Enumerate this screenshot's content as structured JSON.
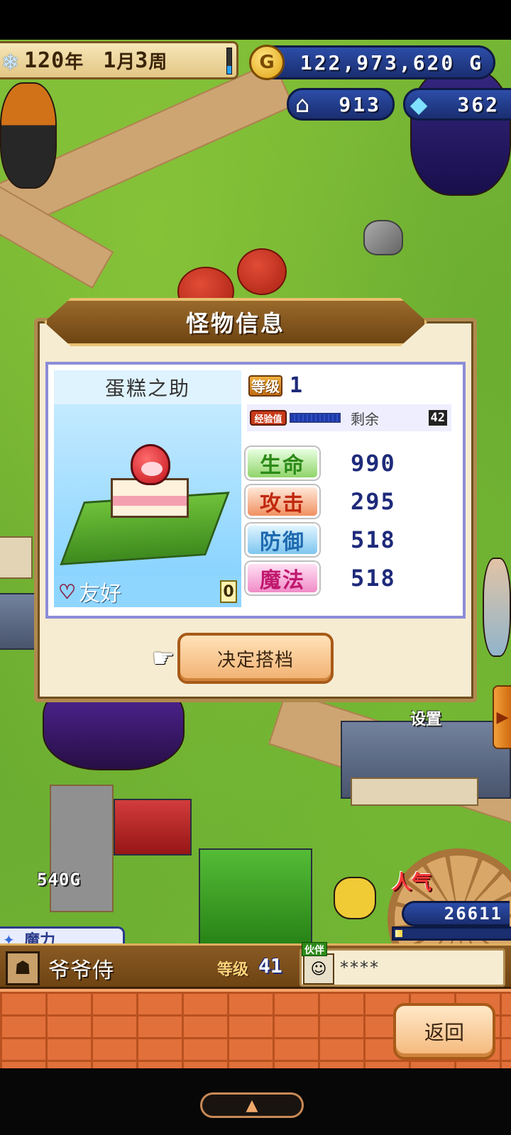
{
  "hud": {
    "date": {
      "year": "120",
      "year_unit": "年",
      "month": "1",
      "month_unit": "月",
      "week": "3",
      "week_unit": "周",
      "progress": 0.3
    },
    "gold": {
      "icon": "G",
      "amount": "122,973,620 G"
    },
    "houses": {
      "icon": "house-icon",
      "count": "913"
    },
    "crystals": {
      "icon": "crystal-icon",
      "count": "362"
    }
  },
  "dialog": {
    "title": "怪物信息",
    "monster": {
      "name": "蛋糕之助",
      "friendship_label": "友好",
      "friendship_value": "0",
      "level_label": "等级",
      "level": "1",
      "exp_label": "经验值",
      "exp_progress": 1.0,
      "exp_remain_label": "剩余",
      "exp_remain_value": "42"
    },
    "stats": [
      {
        "label": "生命",
        "value": "990"
      },
      {
        "label": "攻击",
        "value": "295"
      },
      {
        "label": "防御",
        "value": "518"
      },
      {
        "label": "魔法",
        "value": "518"
      }
    ],
    "confirm_button": "决定搭档"
  },
  "world": {
    "settings_label": "设置",
    "price_label": "540G",
    "magic_label": "魔力",
    "popularity_label": "人气",
    "popularity_value": "26611",
    "popularity_progress": 0.06
  },
  "character": {
    "name": "爷爷侍",
    "level_label": "等级",
    "level": "41",
    "partner_badge": "伙伴",
    "partner_name": "****"
  },
  "footer": {
    "back_button": "返回"
  },
  "colors": {
    "panel_border": "#8d8cd8",
    "hud_blue": "#2c4da8",
    "brick": "#e2703a",
    "button": "#f1b070"
  }
}
